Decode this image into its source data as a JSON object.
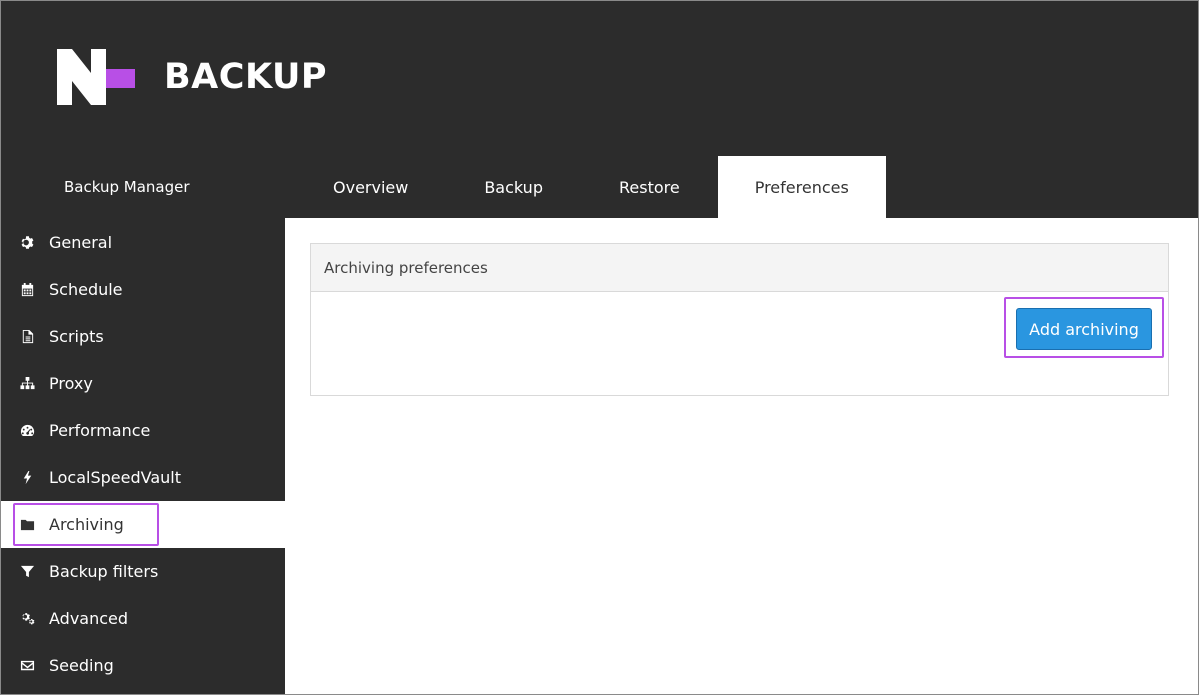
{
  "header": {
    "brand": "BACKUP",
    "brand_color": "#b84fe6"
  },
  "app_name": "Backup Manager",
  "tabs": [
    {
      "label": "Overview",
      "active": false
    },
    {
      "label": "Backup",
      "active": false
    },
    {
      "label": "Restore",
      "active": false
    },
    {
      "label": "Preferences",
      "active": true
    }
  ],
  "sidebar": {
    "items": [
      {
        "label": "General",
        "icon": "gear-icon"
      },
      {
        "label": "Schedule",
        "icon": "calendar-icon"
      },
      {
        "label": "Scripts",
        "icon": "document-icon"
      },
      {
        "label": "Proxy",
        "icon": "sitemap-icon"
      },
      {
        "label": "Performance",
        "icon": "gauge-icon"
      },
      {
        "label": "LocalSpeedVault",
        "icon": "bolt-icon"
      },
      {
        "label": "Archiving",
        "icon": "folder-icon",
        "active": true
      },
      {
        "label": "Backup filters",
        "icon": "filter-icon"
      },
      {
        "label": "Advanced",
        "icon": "gears-icon"
      },
      {
        "label": "Seeding",
        "icon": "envelope-icon"
      }
    ]
  },
  "panel": {
    "title": "Archiving preferences",
    "add_button_label": "Add archiving"
  },
  "colors": {
    "dark_bg": "#2c2c2c",
    "highlight": "#b84fe6",
    "button_blue": "#2a96e0"
  }
}
